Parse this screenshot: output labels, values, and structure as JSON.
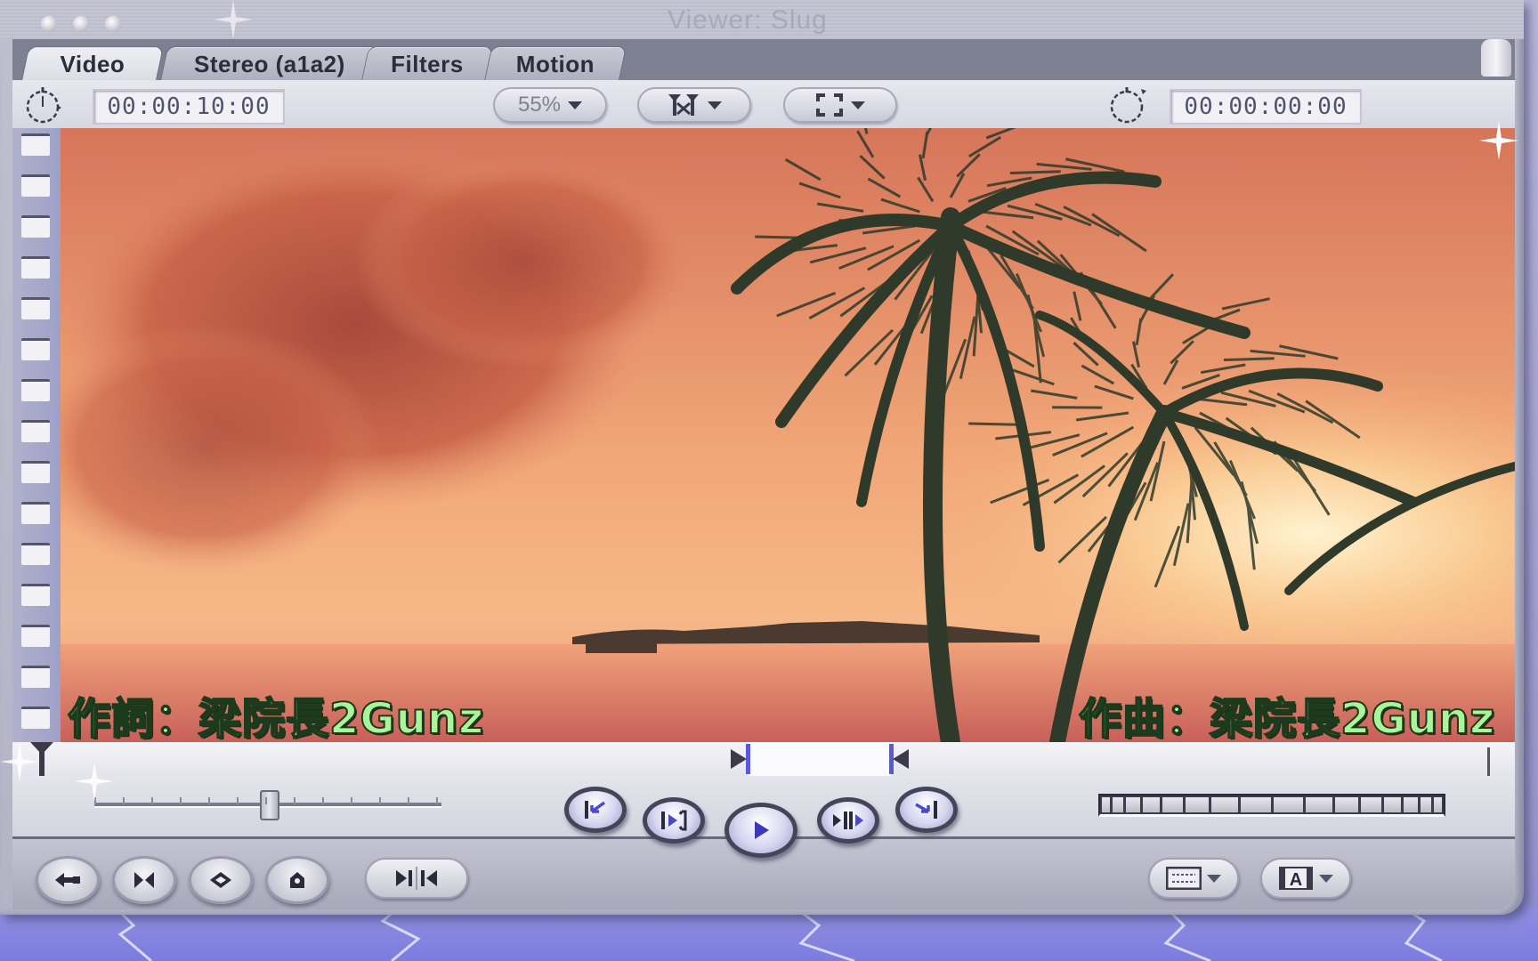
{
  "window": {
    "title": "Viewer: Slug",
    "traffic_lights": [
      "close",
      "minimize",
      "zoom"
    ]
  },
  "tabs": [
    {
      "label": "Video",
      "active": true
    },
    {
      "label": "Stereo (a1a2)",
      "active": false
    },
    {
      "label": "Filters",
      "active": false
    },
    {
      "label": "Motion",
      "active": false
    }
  ],
  "toolbar": {
    "duration_timecode": "00:00:10:00",
    "zoom_popup": "55%",
    "view_popup_icon": "title-safe-overlay-icon",
    "fit_popup_icon": "fit-to-window-icon",
    "current_timecode": "00:00:00:00"
  },
  "video": {
    "description": "Tropical beach sunset with palm trees silhouetted against orange sky",
    "caption_left": "作詞：梁院長2Gunz",
    "caption_right": "作曲：梁院長2Gunz",
    "caption_color": "#aaf59a"
  },
  "scrubber": {
    "playhead_position_fraction": 0.0,
    "in_point_fraction": 0.49,
    "out_point_fraction": 0.585,
    "in_out_color": "#5a5ad8"
  },
  "shuttle": {
    "value_fraction": 0.5
  },
  "transport_buttons": [
    {
      "name": "go-to-in-point",
      "icon": "go-to-in-icon"
    },
    {
      "name": "play-in-to-out",
      "icon": "play-in-to-out-icon"
    },
    {
      "name": "play",
      "icon": "play-icon"
    },
    {
      "name": "play-around-current",
      "icon": "play-around-icon"
    },
    {
      "name": "go-to-out-point",
      "icon": "go-to-out-icon"
    }
  ],
  "jog_wheel": {
    "segments": 16
  },
  "edit_buttons": [
    {
      "name": "insert-edit",
      "icon": "insert-icon"
    },
    {
      "name": "match-frame",
      "icon": "match-frame-icon"
    },
    {
      "name": "add-keyframe",
      "icon": "keyframe-icon"
    },
    {
      "name": "add-marker",
      "icon": "marker-icon"
    },
    {
      "name": "mark-in-out",
      "icon": "mark-in-out-icon"
    }
  ],
  "view_buttons": [
    {
      "name": "recent-clips",
      "icon": "clip-list-icon"
    },
    {
      "name": "generator",
      "icon": "text-generator-icon"
    }
  ],
  "colors": {
    "chrome": "#c4c4d2",
    "tabbar": "#7c8090",
    "accent": "#5a5ad8",
    "background": "#8c8ad8"
  }
}
